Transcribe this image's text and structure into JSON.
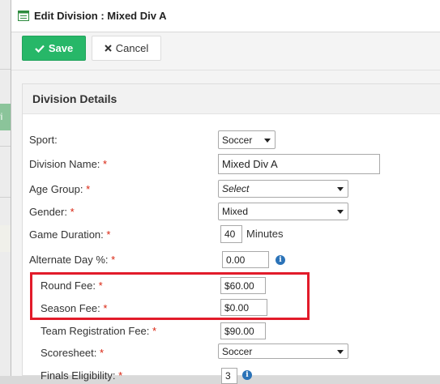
{
  "window": {
    "title": "Edit Division : Mixed Div A"
  },
  "background": {
    "tab_text": "ivi"
  },
  "toolbar": {
    "save_label": "Save",
    "cancel_label": "Cancel"
  },
  "panel": {
    "title": "Division Details"
  },
  "fields": {
    "sport": {
      "label": "Sport:",
      "value": "Soccer"
    },
    "division_name": {
      "label": "Division Name:",
      "required": "*",
      "value": "Mixed Div A"
    },
    "age_group": {
      "label": "Age Group:",
      "required": "*",
      "value": "Select"
    },
    "gender": {
      "label": "Gender:",
      "required": "*",
      "value": "Mixed"
    },
    "game_duration": {
      "label": "Game Duration:",
      "required": "*",
      "value": "40",
      "unit": "Minutes"
    },
    "alternate_day": {
      "label": "Alternate Day %:",
      "required": "*",
      "value": "0.00"
    },
    "round_fee": {
      "label": "Round Fee:",
      "required": "*",
      "value": "$60.00"
    },
    "season_fee": {
      "label": "Season Fee:",
      "required": "*",
      "value": "$0.00"
    },
    "team_registration_fee": {
      "label": "Team Registration Fee:",
      "required": "*",
      "value": "$90.00"
    },
    "scoresheet": {
      "label": "Scoresheet:",
      "required": "*",
      "value": "Soccer"
    },
    "finals_eligibility": {
      "label": "Finals Eligibility:",
      "required": "*",
      "value": "3"
    }
  },
  "colors": {
    "save": "#27b768",
    "highlight": "#e21b2a",
    "info": "#2b73b8",
    "required": "#d9230f"
  }
}
